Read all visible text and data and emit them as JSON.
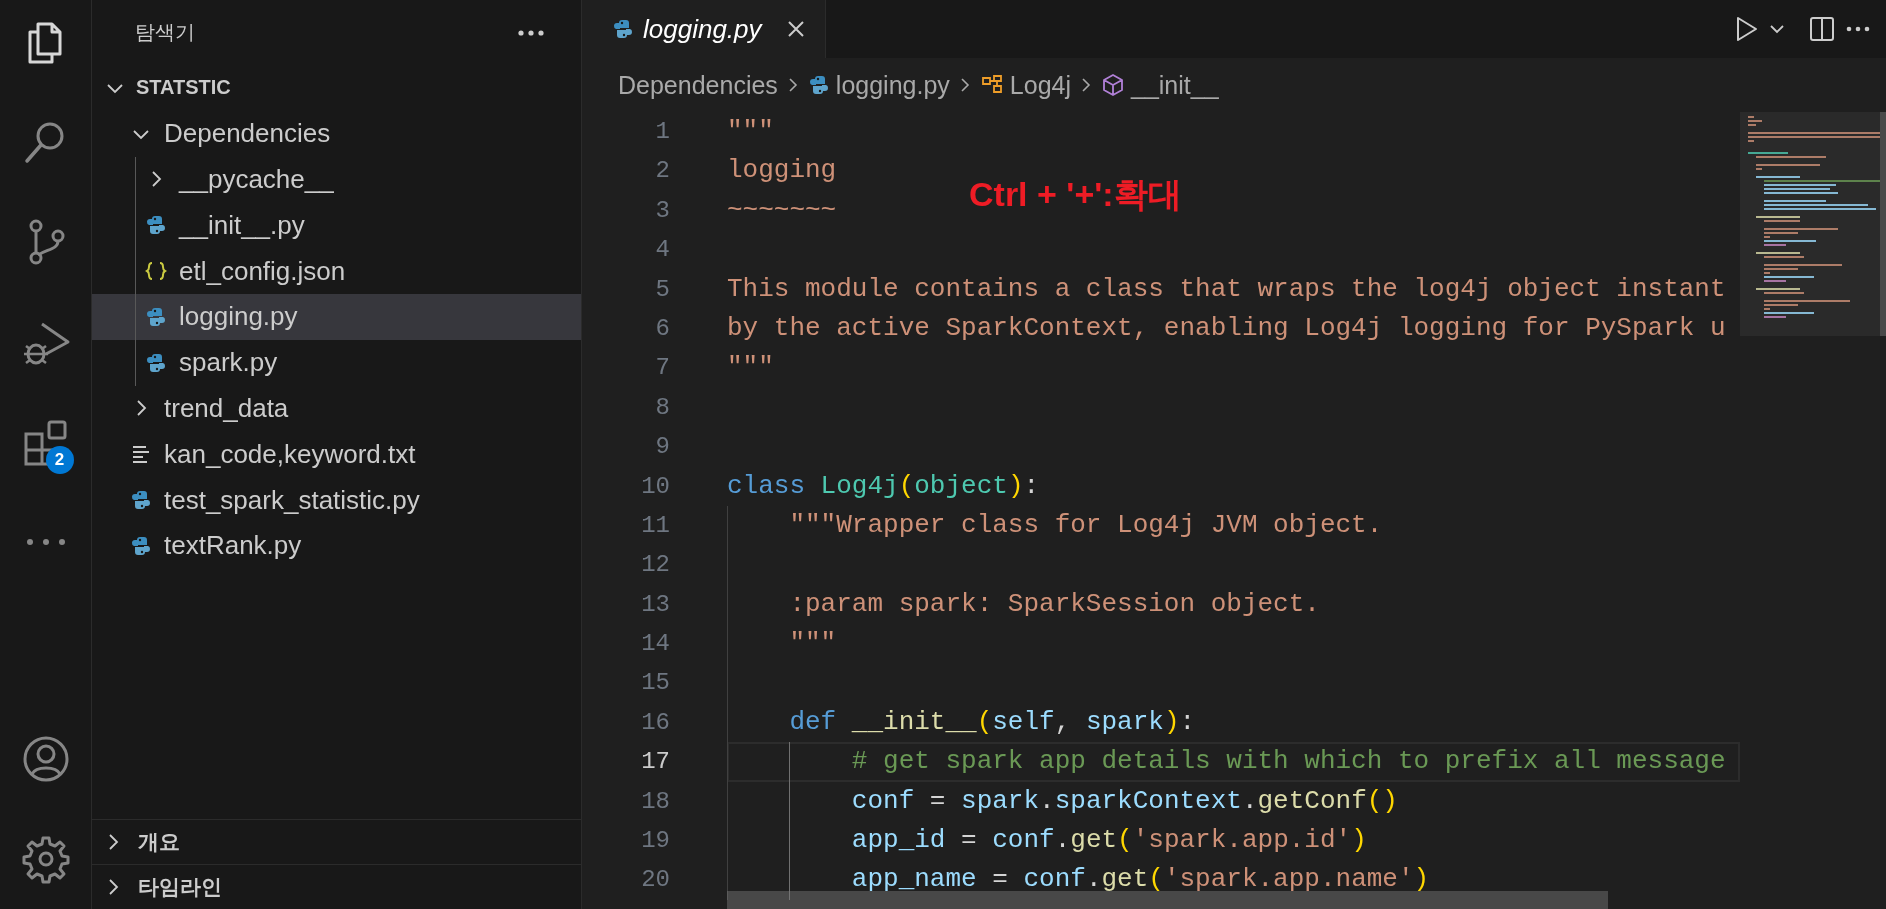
{
  "activity_bar": {
    "items": [
      {
        "kind": "explorer",
        "selected": true
      },
      {
        "kind": "search",
        "selected": false
      },
      {
        "kind": "source-control",
        "selected": false
      },
      {
        "kind": "run-debug",
        "selected": false
      },
      {
        "kind": "extensions",
        "selected": false,
        "badge": "2"
      },
      {
        "kind": "more",
        "selected": false
      }
    ],
    "bottom_items": [
      {
        "kind": "account"
      },
      {
        "kind": "settings"
      }
    ]
  },
  "explorer": {
    "title": "탐색기",
    "workspace": {
      "name": "STATSTIC",
      "expanded": true,
      "children": [
        {
          "name": "Dependencies",
          "kind": "folder",
          "expanded": true,
          "selected": false,
          "children": [
            {
              "name": "__pycache__",
              "kind": "folder",
              "expanded": false,
              "selected": false
            },
            {
              "name": "__init__.py",
              "kind": "python",
              "selected": false
            },
            {
              "name": "etl_config.json",
              "kind": "json",
              "selected": false
            },
            {
              "name": "logging.py",
              "kind": "python",
              "selected": true
            },
            {
              "name": "spark.py",
              "kind": "python",
              "selected": false
            }
          ]
        },
        {
          "name": "trend_data",
          "kind": "folder",
          "expanded": false,
          "selected": false
        },
        {
          "name": "kan_code,keyword.txt",
          "kind": "text",
          "selected": false
        },
        {
          "name": "test_spark_statistic.py",
          "kind": "python",
          "selected": false
        },
        {
          "name": "textRank.py",
          "kind": "python",
          "selected": false
        }
      ]
    },
    "panels": [
      {
        "title": "개요",
        "expanded": false
      },
      {
        "title": "타임라인",
        "expanded": false
      }
    ]
  },
  "tabs": [
    {
      "title": "logging.py",
      "kind": "python",
      "selected": true,
      "preview": true
    }
  ],
  "breadcrumbs": [
    {
      "text": "Dependencies",
      "kind": "folder"
    },
    {
      "text": "logging.py",
      "kind": "python"
    },
    {
      "text": "Log4j",
      "kind": "class"
    },
    {
      "text": "__init__",
      "kind": "method"
    }
  ],
  "lines": [
    {
      "number": "1",
      "current": false,
      "tokens": [
        {
          "kind": "string",
          "text": "\"\"\""
        }
      ]
    },
    {
      "number": "2",
      "current": false,
      "tokens": [
        {
          "kind": "string",
          "text": "logging"
        }
      ]
    },
    {
      "number": "3",
      "current": false,
      "tokens": [
        {
          "kind": "string",
          "text": "~~~~~~~"
        }
      ]
    },
    {
      "number": "4",
      "current": false
    },
    {
      "number": "5",
      "current": false,
      "tokens": [
        {
          "kind": "string",
          "text": "This module contains a class that wraps the log4j object instant"
        }
      ]
    },
    {
      "number": "6",
      "current": false,
      "tokens": [
        {
          "kind": "string",
          "text": "by the active SparkContext, enabling Log4j logging for PySpark u"
        }
      ]
    },
    {
      "number": "7",
      "current": false,
      "tokens": [
        {
          "kind": "string",
          "text": "\"\"\""
        }
      ]
    },
    {
      "number": "8",
      "current": false
    },
    {
      "number": "9",
      "current": false
    },
    {
      "number": "10",
      "current": false,
      "tokens": [
        {
          "kind": "keyword",
          "text": "class"
        },
        {
          "kind": "class",
          "text": " Log4j"
        },
        {
          "kind": "bracket",
          "text": "("
        },
        {
          "kind": "class",
          "text": "object"
        },
        {
          "kind": "bracket",
          "text": ")"
        },
        {
          "kind": "plain",
          "text": ":"
        }
      ]
    },
    {
      "number": "11",
      "current": false,
      "tokens": [
        {
          "kind": "string",
          "text": "    \"\"\"Wrapper class for Log4j JVM object."
        }
      ]
    },
    {
      "number": "12",
      "current": false
    },
    {
      "number": "13",
      "current": false,
      "tokens": [
        {
          "kind": "string",
          "text": "    :param spark: SparkSession object."
        }
      ]
    },
    {
      "number": "14",
      "current": false,
      "tokens": [
        {
          "kind": "string",
          "text": "    \"\"\""
        }
      ]
    },
    {
      "number": "15",
      "current": false
    },
    {
      "number": "16",
      "current": false,
      "tokens": [
        {
          "kind": "keyword",
          "text": "    def"
        },
        {
          "kind": "function",
          "text": " __init__"
        },
        {
          "kind": "bracket",
          "text": "("
        },
        {
          "kind": "variable",
          "text": "self"
        },
        {
          "kind": "plain",
          "text": ", "
        },
        {
          "kind": "variable",
          "text": "spark"
        },
        {
          "kind": "bracket",
          "text": ")"
        },
        {
          "kind": "plain",
          "text": ":"
        }
      ]
    },
    {
      "number": "17",
      "current": true,
      "tokens": [
        {
          "kind": "comment",
          "text": "        # get spark app details with which to prefix all message"
        }
      ]
    },
    {
      "number": "18",
      "current": false,
      "tokens": [
        {
          "kind": "variable",
          "text": "        conf"
        },
        {
          "kind": "plain",
          "text": " = "
        },
        {
          "kind": "variable",
          "text": "spark"
        },
        {
          "kind": "plain",
          "text": "."
        },
        {
          "kind": "variable",
          "text": "sparkContext"
        },
        {
          "kind": "plain",
          "text": "."
        },
        {
          "kind": "function",
          "text": "getConf"
        },
        {
          "kind": "bracket",
          "text": "()"
        }
      ]
    },
    {
      "number": "19",
      "current": false,
      "tokens": [
        {
          "kind": "variable",
          "text": "        app_id"
        },
        {
          "kind": "plain",
          "text": " = "
        },
        {
          "kind": "variable",
          "text": "conf"
        },
        {
          "kind": "plain",
          "text": "."
        },
        {
          "kind": "function",
          "text": "get"
        },
        {
          "kind": "bracket",
          "text": "("
        },
        {
          "kind": "string",
          "text": "'spark.app.id'"
        },
        {
          "kind": "bracket",
          "text": ")"
        }
      ]
    },
    {
      "number": "20",
      "current": false,
      "tokens": [
        {
          "kind": "variable",
          "text": "        app_name"
        },
        {
          "kind": "plain",
          "text": " = "
        },
        {
          "kind": "variable",
          "text": "conf"
        },
        {
          "kind": "plain",
          "text": "."
        },
        {
          "kind": "function",
          "text": "get"
        },
        {
          "kind": "bracket",
          "text": "("
        },
        {
          "kind": "string",
          "text": "'spark.app.name'"
        },
        {
          "kind": "bracket",
          "text": ")"
        }
      ]
    }
  ],
  "annotation": {
    "text": "Ctrl + '+':확대"
  }
}
